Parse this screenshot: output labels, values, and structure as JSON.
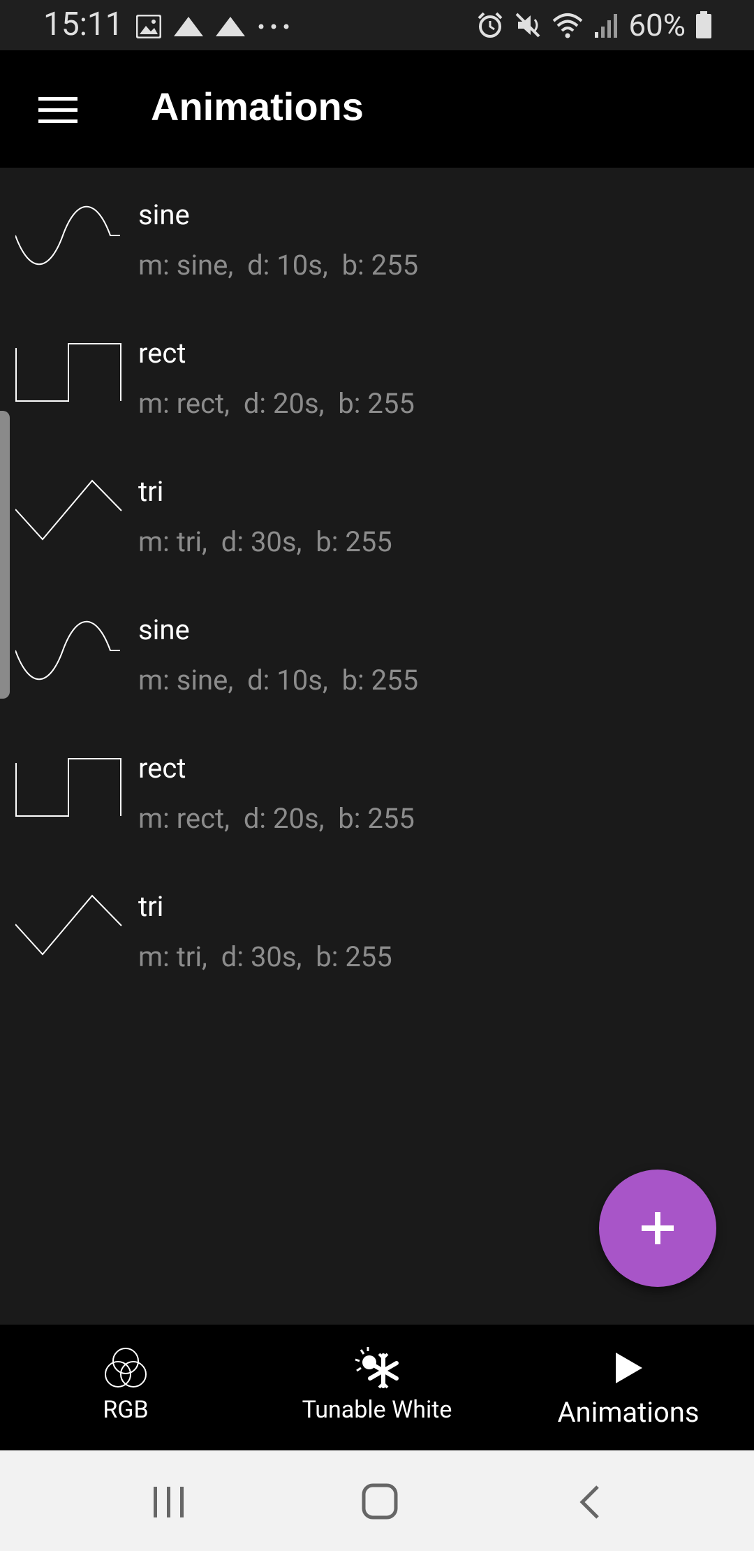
{
  "status_bar": {
    "time": "15:11",
    "left_icons": [
      "image-icon",
      "upload-icon",
      "upload-icon",
      "more-icon"
    ],
    "right_icons": [
      "alarm-icon",
      "mute-icon",
      "wifi-icon",
      "signal-icon"
    ],
    "battery": "60%"
  },
  "app_bar": {
    "title": "Animations"
  },
  "animations": [
    {
      "name": "sine",
      "meta": "m: sine,  d: 10s,  b: 255",
      "wave": "sine"
    },
    {
      "name": "rect",
      "meta": "m: rect,  d: 20s,  b: 255",
      "wave": "rect"
    },
    {
      "name": "tri",
      "meta": "m: tri,  d: 30s,  b: 255",
      "wave": "tri"
    },
    {
      "name": "sine",
      "meta": "m: sine,  d: 10s,  b: 255",
      "wave": "sine"
    },
    {
      "name": "rect",
      "meta": "m: rect,  d: 20s,  b: 255",
      "wave": "rect"
    },
    {
      "name": "tri",
      "meta": "m: tri,  d: 30s,  b: 255",
      "wave": "tri"
    }
  ],
  "fab": {
    "icon": "plus-icon",
    "color": "#a855c8"
  },
  "bottom_nav": {
    "items": [
      {
        "label": "RGB",
        "icon": "rgb-circles-icon"
      },
      {
        "label": "Tunable White",
        "icon": "sun-snowflake-icon"
      },
      {
        "label": "Animations",
        "icon": "play-icon",
        "active": true
      }
    ]
  },
  "system_nav": {
    "items": [
      "recents-icon",
      "home-icon",
      "back-icon"
    ]
  }
}
